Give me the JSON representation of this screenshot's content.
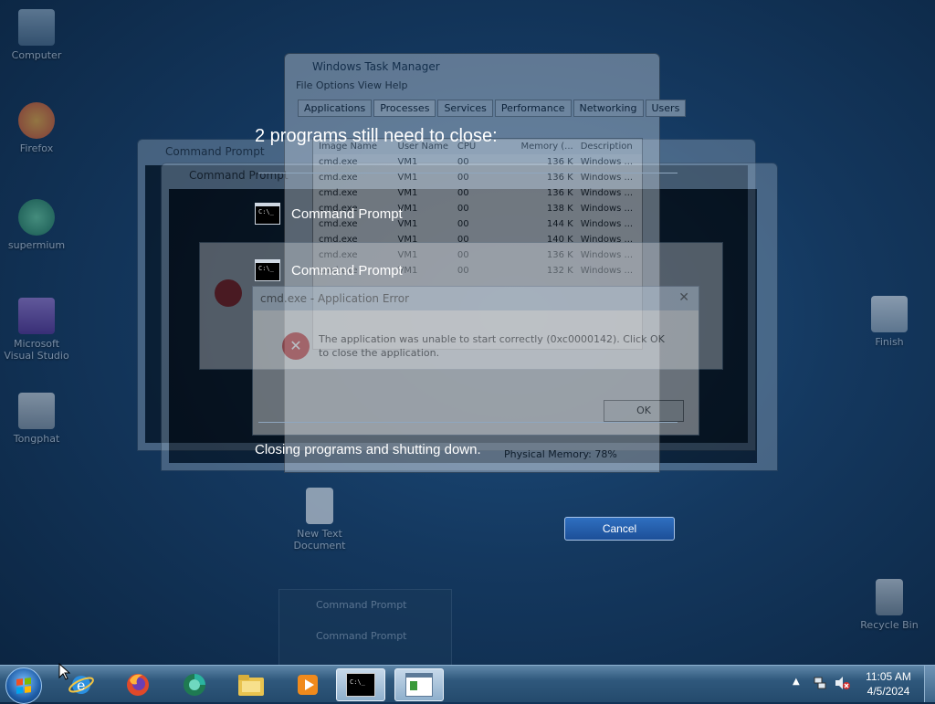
{
  "desktop": {
    "icons": [
      {
        "label": "Computer"
      },
      {
        "label": "Firefox"
      },
      {
        "label": "supermium"
      },
      {
        "label": "Microsoft Visual Studio"
      },
      {
        "label": "Tongphat"
      },
      {
        "label": "Finish"
      },
      {
        "label": "Recycle Bin"
      },
      {
        "label": "New Text Document"
      }
    ]
  },
  "background": {
    "task_manager": {
      "title": "Windows Task Manager",
      "menu": "File  Options  View  Help",
      "tabs": [
        "Applications",
        "Processes",
        "Services",
        "Performance",
        "Networking",
        "Users"
      ],
      "selected_tab": "Processes",
      "columns": [
        "Image Name",
        "User Name",
        "CPU",
        "Memory (...",
        "Description"
      ],
      "rows": [
        [
          "cmd.exe",
          "VM1",
          "00",
          "136 K",
          "Windows ..."
        ],
        [
          "cmd.exe",
          "VM1",
          "00",
          "136 K",
          "Windows ..."
        ],
        [
          "cmd.exe",
          "VM1",
          "00",
          "136 K",
          "Windows ..."
        ],
        [
          "cmd.exe",
          "VM1",
          "00",
          "138 K",
          "Windows ..."
        ],
        [
          "cmd.exe",
          "VM1",
          "00",
          "144 K",
          "Windows ..."
        ],
        [
          "cmd.exe",
          "VM1",
          "00",
          "140 K",
          "Windows ..."
        ],
        [
          "cmd.exe",
          "VM1",
          "00",
          "136 K",
          "Windows ..."
        ],
        [
          "cmd.exe",
          "VM1",
          "00",
          "132 K",
          "Windows ..."
        ]
      ],
      "status": "Physical Memory: 78%"
    },
    "cmd_window_1_title": "Command Prompt",
    "cmd_window_2_title": "Command Prompt",
    "error_dialog": {
      "title": "cmd.exe - Application Error",
      "message": "The application was unable to start correctly (0xc0000142). Click OK to close the application.",
      "ok_label": "OK"
    },
    "jump_list": [
      "Command Prompt",
      "Command Prompt"
    ]
  },
  "shutdown": {
    "title": "2 programs still need to close:",
    "programs": [
      {
        "label": "Command Prompt",
        "icon": "command-prompt-icon"
      },
      {
        "label": "Command Prompt",
        "icon": "command-prompt-icon"
      }
    ],
    "status": "Closing programs and shutting down.",
    "cancel_label": "Cancel"
  },
  "taskbar": {
    "items": [
      "start-orb-icon",
      "internet-explorer-icon",
      "firefox-icon",
      "supermium-icon",
      "file-explorer-icon",
      "media-player-icon",
      "command-prompt-icon",
      "task-manager-icon"
    ],
    "clock": {
      "time": "11:05 AM",
      "date": "4/5/2024"
    }
  }
}
